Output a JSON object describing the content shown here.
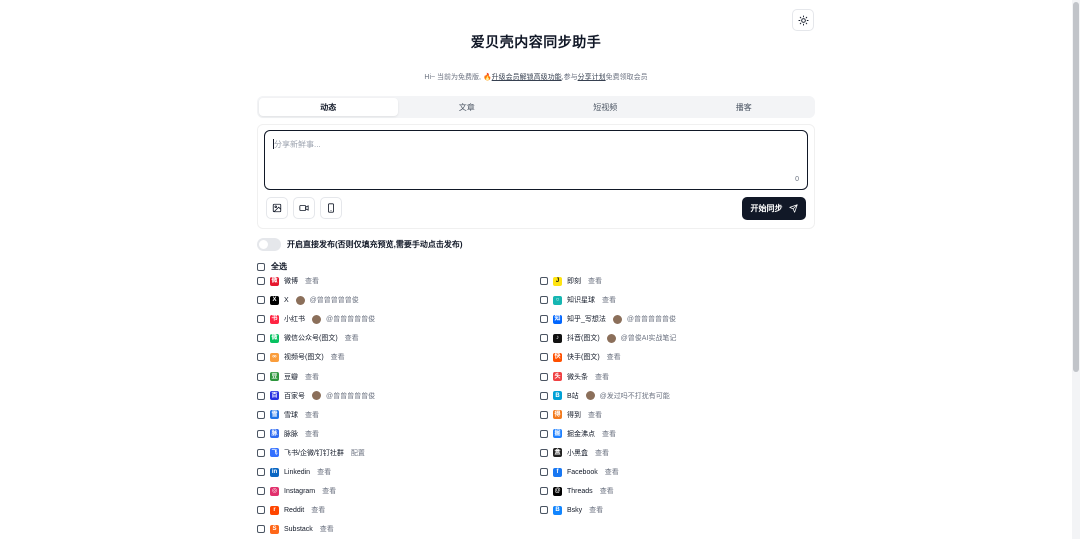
{
  "header": {
    "title": "爱贝壳内容同步助手",
    "notice_prefix": "Hi~ 当前为免费版,",
    "notice_icon": "🔥",
    "notice_upgrade": "升级会员解锁高级功能",
    "notice_mid": ",参与",
    "notice_share": "分享计划",
    "notice_suffix": "免费领取会员"
  },
  "tabs": [
    {
      "label": "动态",
      "active": true
    },
    {
      "label": "文章",
      "active": false
    },
    {
      "label": "短视频",
      "active": false
    },
    {
      "label": "播客",
      "active": false
    }
  ],
  "editor": {
    "placeholder": "分享新鲜事...",
    "char_count": "0",
    "sync_label": "开始同步"
  },
  "direct_publish": {
    "label": "开启直接发布(否则仅填充预览,需要手动点击发布)",
    "enabled": false
  },
  "select_all_label": "全选",
  "platforms_left": [
    {
      "name": "微博",
      "icon": "weibo-icon",
      "color": "#e6162d",
      "glyph": "微",
      "action": "查看"
    },
    {
      "name": "X",
      "icon": "x-icon",
      "color": "#000000",
      "glyph": "X",
      "account": "@曾曾曾曾曾俊"
    },
    {
      "name": "小红书",
      "icon": "xiaohongshu-icon",
      "color": "#ff2442",
      "glyph": "书",
      "account": "@曾曾曾曾曾俊"
    },
    {
      "name": "微信公众号(图文)",
      "icon": "wechat-icon",
      "color": "#07c160",
      "glyph": "微",
      "action": "查看"
    },
    {
      "name": "视频号(图文)",
      "icon": "channels-icon",
      "color": "#fa9d3b",
      "glyph": "∞",
      "action": "查看"
    },
    {
      "name": "豆瓣",
      "icon": "douban-icon",
      "color": "#2e963d",
      "glyph": "豆",
      "action": "查看"
    },
    {
      "name": "百家号",
      "icon": "baijiahao-icon",
      "color": "#2932e1",
      "glyph": "百",
      "account": "@曾曾曾曾曾俊"
    },
    {
      "name": "雪球",
      "icon": "xueqiu-icon",
      "color": "#1f74e6",
      "glyph": "雪",
      "action": "查看"
    },
    {
      "name": "脉脉",
      "icon": "maimai-icon",
      "color": "#2f6bf1",
      "glyph": "脉",
      "action": "查看"
    },
    {
      "name": "飞书/企微/钉钉社群",
      "icon": "feishu-icon",
      "color": "#3370ff",
      "glyph": "飞",
      "action": "配置"
    },
    {
      "name": "Linkedin",
      "icon": "linkedin-icon",
      "color": "#0a66c2",
      "glyph": "in",
      "action": "查看"
    },
    {
      "name": "Instagram",
      "icon": "instagram-icon",
      "color": "#e1306c",
      "glyph": "◎",
      "action": "查看"
    },
    {
      "name": "Reddit",
      "icon": "reddit-icon",
      "color": "#ff4500",
      "glyph": "r",
      "action": "查看"
    },
    {
      "name": "Substack",
      "icon": "substack-icon",
      "color": "#ff6719",
      "glyph": "S",
      "action": "查看"
    }
  ],
  "platforms_right": [
    {
      "name": "即刻",
      "icon": "jike-icon",
      "color": "#ffe411",
      "glyph": "J",
      "action": "查看"
    },
    {
      "name": "知识星球",
      "icon": "zsxq-icon",
      "color": "#16b6b2",
      "glyph": "○",
      "action": "查看"
    },
    {
      "name": "知乎_写想法",
      "icon": "zhihu-icon",
      "color": "#0066ff",
      "glyph": "知",
      "account": "@曾曾曾曾曾俊"
    },
    {
      "name": "抖音(图文)",
      "icon": "douyin-icon",
      "color": "#111111",
      "glyph": "♪",
      "account": "@曾俊AI实战笔记"
    },
    {
      "name": "快手(图文)",
      "icon": "kuaishou-icon",
      "color": "#ff5000",
      "glyph": "快",
      "action": "查看"
    },
    {
      "name": "微头条",
      "icon": "toutiao-icon",
      "color": "#f04142",
      "glyph": "头",
      "action": "查看"
    },
    {
      "name": "B站",
      "icon": "bilibili-icon",
      "color": "#00a1d6",
      "glyph": "B",
      "account": "@发过吗不打扰有可能"
    },
    {
      "name": "得到",
      "icon": "dedao-icon",
      "color": "#f37b1d",
      "glyph": "得",
      "action": "查看"
    },
    {
      "name": "掘金沸点",
      "icon": "juejin-icon",
      "color": "#1e80ff",
      "glyph": "掘",
      "action": "查看"
    },
    {
      "name": "小黑盒",
      "icon": "xiaoheihe-icon",
      "color": "#222222",
      "glyph": "盒",
      "action": "查看"
    },
    {
      "name": "Facebook",
      "icon": "facebook-icon",
      "color": "#1877f2",
      "glyph": "f",
      "action": "查看"
    },
    {
      "name": "Threads",
      "icon": "threads-icon",
      "color": "#000000",
      "glyph": "@",
      "action": "查看"
    },
    {
      "name": "Bsky",
      "icon": "bluesky-icon",
      "color": "#1185fe",
      "glyph": "B",
      "action": "查看"
    }
  ]
}
